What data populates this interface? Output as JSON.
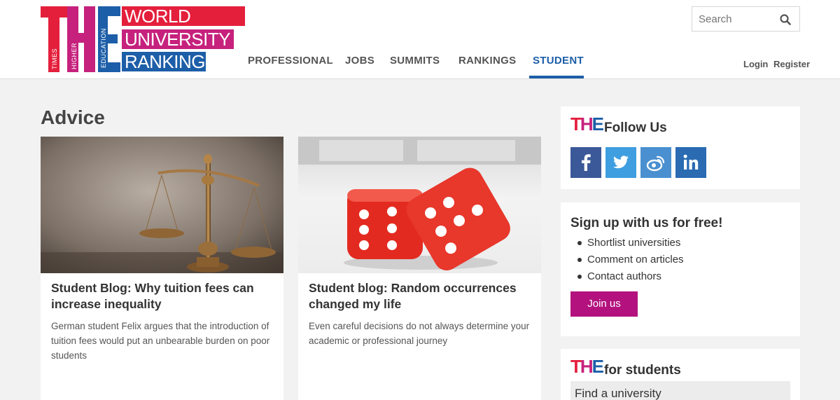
{
  "header": {
    "logo": {
      "the": "THE",
      "small": [
        "TIMES",
        "HIGHER",
        "EDUCATION"
      ],
      "words": [
        "WORLD",
        "UNIVERSITY",
        "RANKINGS"
      ]
    },
    "nav": [
      "PROFESSIONAL",
      "JOBS",
      "SUMMITS",
      "RANKINGS",
      "STUDENT"
    ],
    "active_nav": "STUDENT",
    "search_placeholder": "Search",
    "login": "Login",
    "register": "Register"
  },
  "main": {
    "title": "Advice",
    "cards": [
      {
        "title": "Student Blog: Why tuition fees can increase inequality",
        "desc": "German student Felix argues that the introduction of tuition fees would put an unbearable burden on poor students",
        "image": "scales-of-justice"
      },
      {
        "title": "Student blog: Random occurrences changed my life",
        "desc": "Even careful decisions do not always determine your academic or professional journey",
        "image": "red-dice"
      }
    ]
  },
  "sidebar": {
    "follow": {
      "mini_logo": "THE",
      "heading": "Follow Us",
      "networks": [
        {
          "name": "facebook",
          "color": "#3b5998"
        },
        {
          "name": "twitter",
          "color": "#3f9ee0"
        },
        {
          "name": "weibo",
          "color": "#4a90d0"
        },
        {
          "name": "linkedin",
          "color": "#2a6bb2"
        }
      ]
    },
    "signup": {
      "heading": "Sign up with us for free!",
      "items": [
        "Shortlist universities",
        "Comment on articles",
        "Contact authors"
      ],
      "button": "Join us",
      "button_color": "#b3127e"
    },
    "students": {
      "mini_logo": "THE",
      "heading": "for students",
      "link": "Find a university"
    }
  },
  "colors": {
    "red": "#e41f3c",
    "magenta": "#c6217d",
    "blue": "#1d5ea8"
  }
}
